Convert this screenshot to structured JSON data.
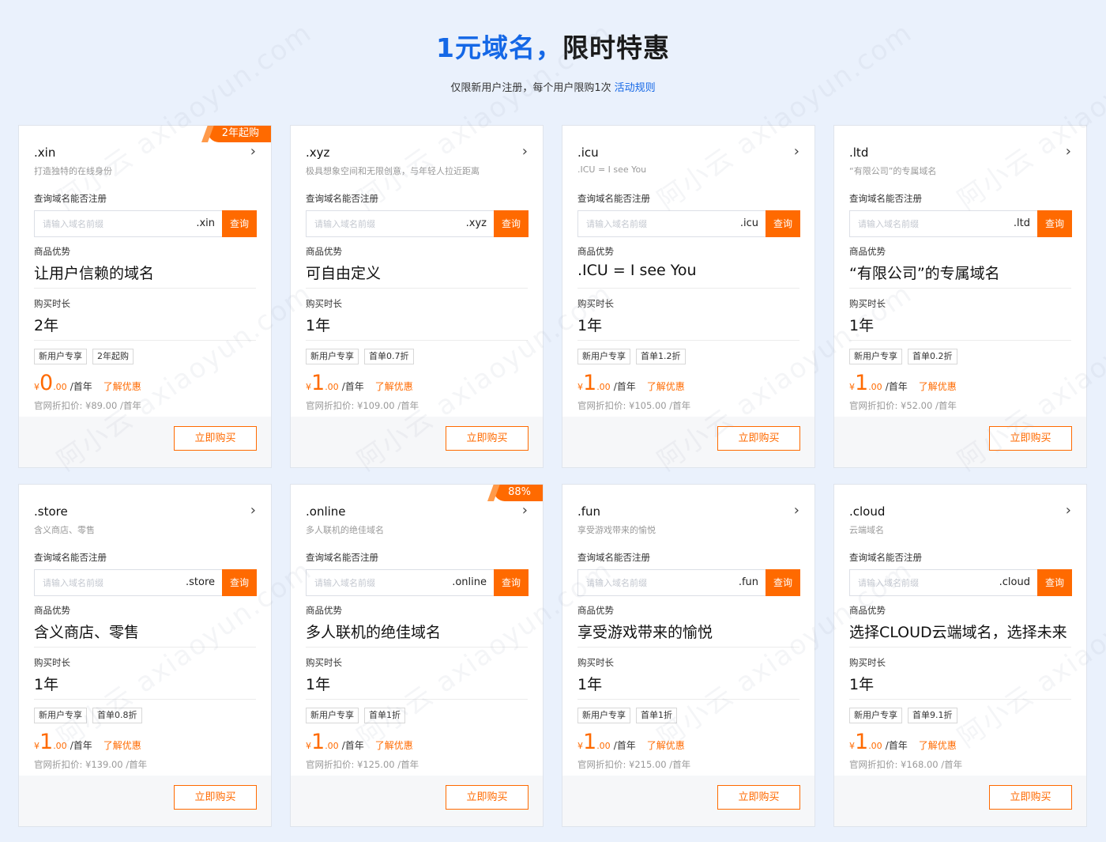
{
  "hero": {
    "title_accent": "1元域名，",
    "title_rest": "限时特惠",
    "subtitle": "仅限新用户注册，每个用户限购1次",
    "rule_link": "活动规则"
  },
  "labels": {
    "check": "查询域名能否注册",
    "advantage": "商品优势",
    "duration": "购买时长",
    "placeholder": "请输入域名前缀",
    "search_btn": "查询",
    "buy_btn": "立即购买",
    "learn_more": "了解优惠",
    "unit": "/首年",
    "orig_prefix": "官网折扣价: ¥",
    "orig_suffix": " /首年",
    "currency": "¥",
    "decimal": ".00"
  },
  "watermark": "阿小云  axiaoyun.com",
  "cards": [
    {
      "name": ".xin",
      "ribbon": "2年起购",
      "desc": "打造独特的在线身份",
      "suffix": ".xin",
      "advantage": "让用户信赖的域名",
      "duration": "2年",
      "tags": [
        "新用户专享",
        "2年起购"
      ],
      "price": "0",
      "orig": "89.00"
    },
    {
      "name": ".xyz",
      "ribbon": "",
      "desc": "极具想象空间和无限创意，与年轻人拉近距离",
      "suffix": ".xyz",
      "advantage": "可自由定义",
      "duration": "1年",
      "tags": [
        "新用户专享",
        "首单0.7折"
      ],
      "price": "1",
      "orig": "109.00"
    },
    {
      "name": ".icu",
      "ribbon": "",
      "desc": ".ICU = I see You",
      "suffix": ".icu",
      "advantage": ".ICU = I see You",
      "duration": "1年",
      "tags": [
        "新用户专享",
        "首单1.2折"
      ],
      "price": "1",
      "orig": "105.00"
    },
    {
      "name": ".ltd",
      "ribbon": "",
      "desc": "“有限公司”的专属域名",
      "suffix": ".ltd",
      "advantage": "“有限公司”的专属域名",
      "duration": "1年",
      "tags": [
        "新用户专享",
        "首单0.2折"
      ],
      "price": "1",
      "orig": "52.00"
    },
    {
      "name": ".store",
      "ribbon": "",
      "desc": "含义商店、零售",
      "suffix": ".store",
      "advantage": "含义商店、零售",
      "duration": "1年",
      "tags": [
        "新用户专享",
        "首单0.8折"
      ],
      "price": "1",
      "orig": "139.00"
    },
    {
      "name": ".online",
      "ribbon": "88%",
      "desc": "多人联机的绝佳域名",
      "suffix": ".online",
      "advantage": "多人联机的绝佳域名",
      "duration": "1年",
      "tags": [
        "新用户专享",
        "首单1折"
      ],
      "price": "1",
      "orig": "125.00"
    },
    {
      "name": ".fun",
      "ribbon": "",
      "desc": "享受游戏带来的愉悦",
      "suffix": ".fun",
      "advantage": "享受游戏带来的愉悦",
      "duration": "1年",
      "tags": [
        "新用户专享",
        "首单1折"
      ],
      "price": "1",
      "orig": "215.00"
    },
    {
      "name": ".cloud",
      "ribbon": "",
      "desc": "云端域名",
      "suffix": ".cloud",
      "advantage": "选择CLOUD云端域名，选择未来",
      "duration": "1年",
      "tags": [
        "新用户专享",
        "首单9.1折"
      ],
      "price": "1",
      "orig": "168.00"
    }
  ],
  "colors": {
    "accent": "#1467e6",
    "orange": "#ff6a00"
  },
  "icons": {
    "arrow": "chevron-right-icon"
  }
}
